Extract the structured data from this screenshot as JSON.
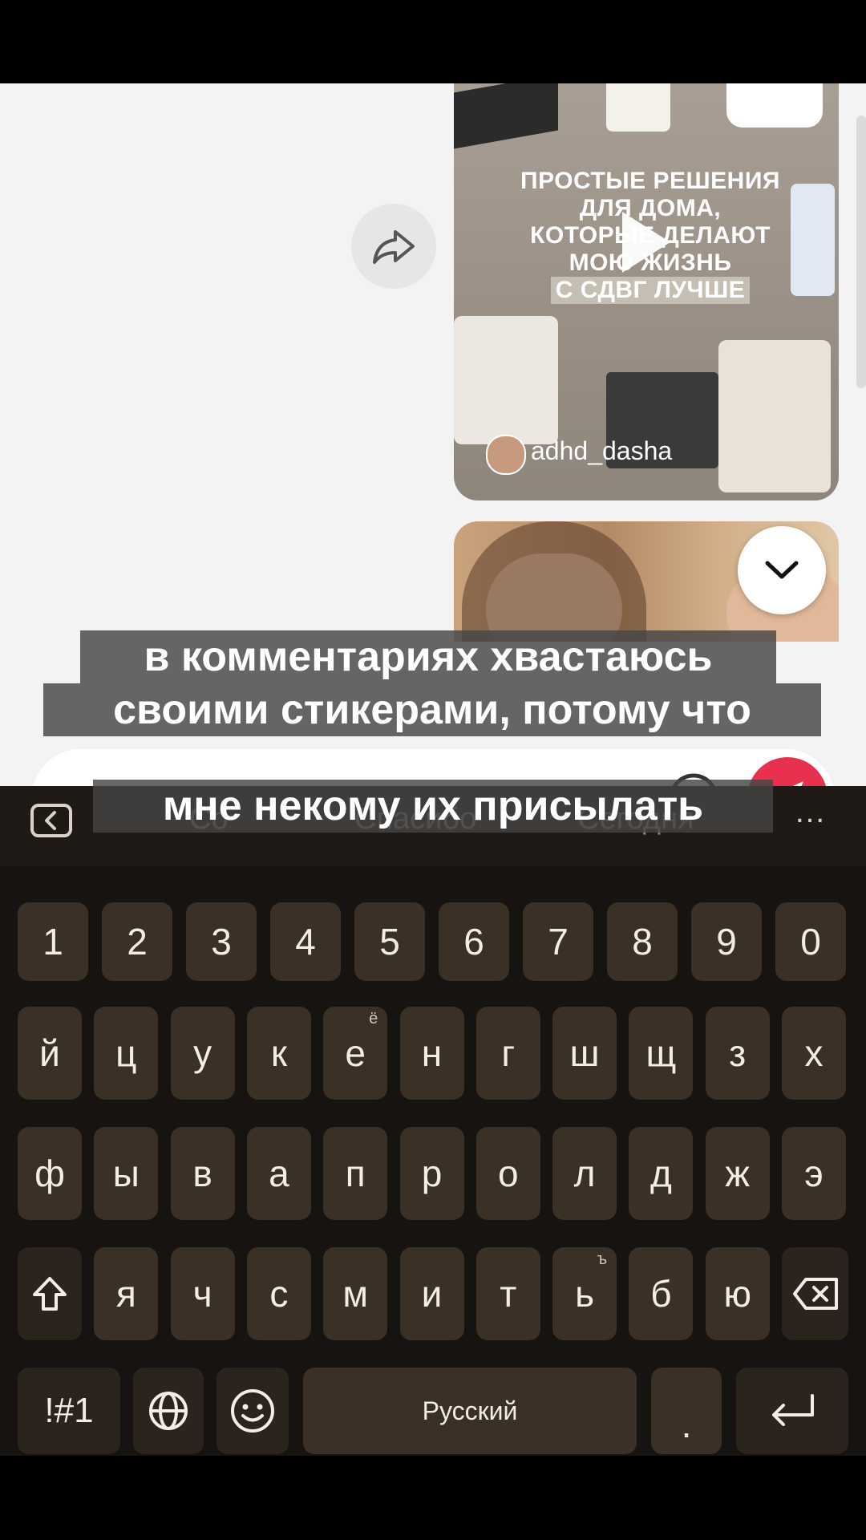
{
  "video_preview": {
    "title_lines": [
      "ПРОСТЫЕ РЕШЕНИЯ",
      "ДЛЯ ДОМА,",
      "КОТОРЫЕ ДЕЛАЮТ",
      "МОЮ ЖИЗНЬ",
      "С СДВГ ЛУЧШЕ"
    ],
    "username": "adhd_dasha"
  },
  "input": {
    "text": "C|"
  },
  "keyboard": {
    "suggestions": [
      "Со",
      "Спасибо",
      "Сегодня"
    ],
    "number_row": [
      "1",
      "2",
      "3",
      "4",
      "5",
      "6",
      "7",
      "8",
      "9",
      "0"
    ],
    "row1": [
      "й",
      "ц",
      "у",
      "к",
      "е",
      "н",
      "г",
      "ш",
      "щ",
      "з",
      "х"
    ],
    "row1_alt": {
      "е": "ё"
    },
    "row2": [
      "ф",
      "ы",
      "в",
      "а",
      "п",
      "р",
      "о",
      "л",
      "д",
      "ж",
      "э"
    ],
    "row3": [
      "я",
      "ч",
      "с",
      "м",
      "и",
      "т",
      "ь",
      "б",
      "ю"
    ],
    "row3_alt": {
      "ь": "ъ"
    },
    "symbols_label": "!#1",
    "space_label": "Русский",
    "period_label": "."
  },
  "caption": {
    "lines": [
      "в комментариях хвастаюсь",
      "своими стикерами, потому что",
      "мне некому их присылать"
    ]
  },
  "colors": {
    "send": "#e8304f",
    "chat_bg": "#f3f3f4",
    "keyboard_bg": "#161310",
    "key_bg": "#3a3026"
  }
}
